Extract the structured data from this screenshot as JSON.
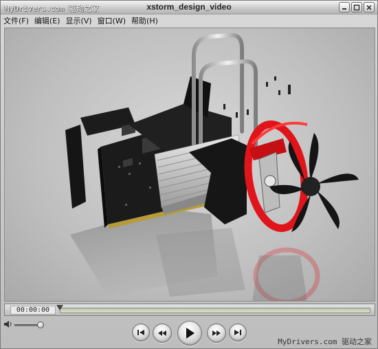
{
  "window": {
    "title": "xstorm_design_video",
    "watermark_top": "MyDrivers.com 驱动之家"
  },
  "menu": {
    "items": [
      "文件(F)",
      "编辑(E)",
      "显示(V)",
      "窗口(W)",
      "帮助(H)"
    ]
  },
  "player": {
    "timecode": "00:00:00",
    "progress": 0,
    "volume": 0.95,
    "watermark_bottom": "MyDrivers.com 驱动之家"
  },
  "controls": {
    "icons": [
      "skip-back-icon",
      "rewind-icon",
      "play-icon",
      "fast-forward-icon",
      "skip-forward-icon"
    ]
  },
  "colors": {
    "fan_shroud": "#e0141b",
    "heatsink": "#c7c7c7",
    "pcb": "#1b1b1b",
    "background": "#c4c4c4",
    "track": "#cbd6bb"
  }
}
